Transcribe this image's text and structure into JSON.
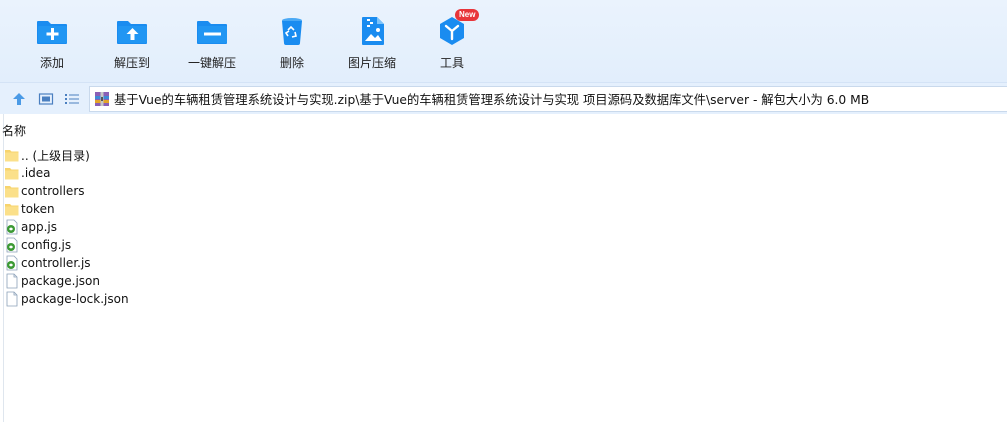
{
  "toolbar": {
    "add": "添加",
    "extract": "解压到",
    "one_click": "一键解压",
    "delete": "删除",
    "img_compress": "图片压缩",
    "tools": "工具",
    "tools_badge": "New"
  },
  "address": {
    "path": "基于Vue的车辆租赁管理系统设计与实现.zip\\基于Vue的车辆租赁管理系统设计与实现 项目源码及数据库文件\\server - 解包大小为 6.0 MB"
  },
  "list": {
    "column_name": "名称",
    "rows": [
      {
        "name": ".. (上级目录)",
        "type": "folder"
      },
      {
        "name": ".idea",
        "type": "folder"
      },
      {
        "name": "controllers",
        "type": "folder"
      },
      {
        "name": "token",
        "type": "folder"
      },
      {
        "name": "app.js",
        "type": "js"
      },
      {
        "name": "config.js",
        "type": "js"
      },
      {
        "name": "controller.js",
        "type": "js"
      },
      {
        "name": "package.json",
        "type": "file"
      },
      {
        "name": "package-lock.json",
        "type": "file"
      }
    ]
  },
  "colors": {
    "accent": "#1a8cf0",
    "toolbar_bg": "#e6f0fc",
    "folder": "#f7d46e",
    "badge": "#e8353a"
  }
}
